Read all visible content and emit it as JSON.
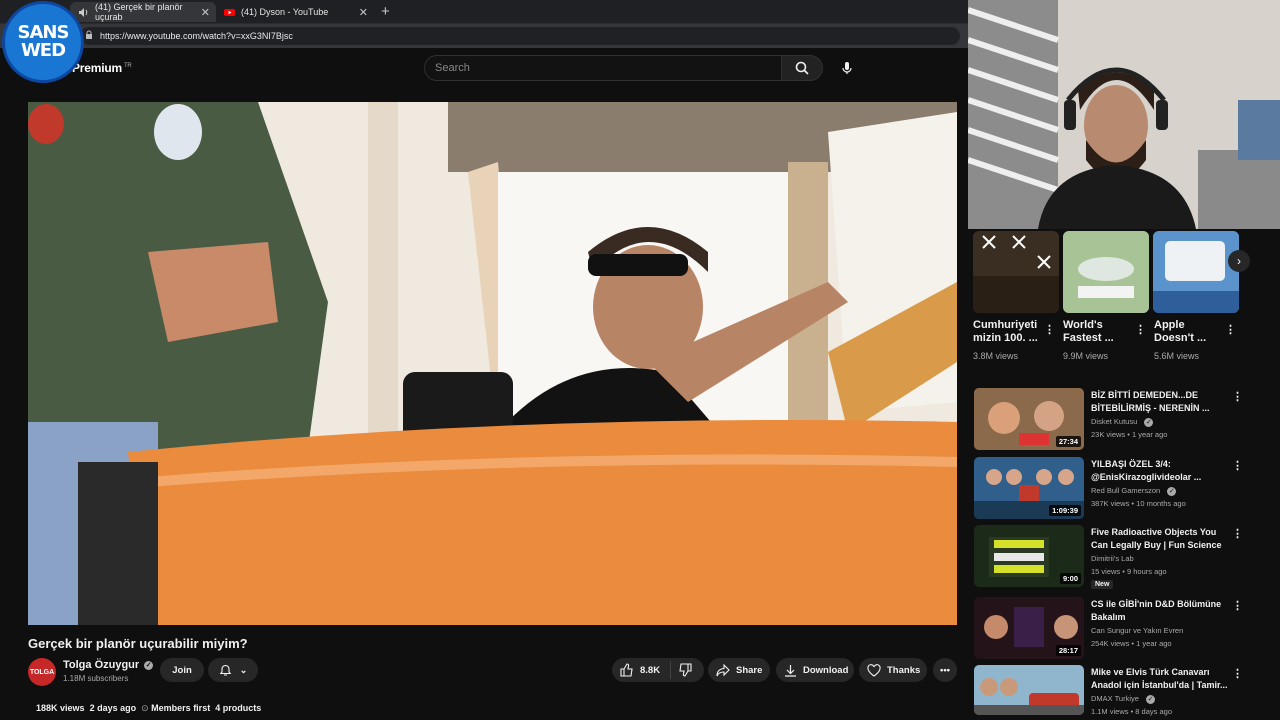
{
  "browser": {
    "tabs": [
      {
        "label": "(41) Gerçek bir planör uçurab"
      },
      {
        "label": "(41) Dyson - YouTube"
      }
    ],
    "url": "https://www.youtube.com/watch?v=xxG3NI7Bjsc"
  },
  "overlay_logo": {
    "line1": "SANS",
    "line2": "WED"
  },
  "header": {
    "brand": "Premium",
    "brand_sup": "TR",
    "search_placeholder": "Search"
  },
  "video": {
    "title": "Gerçek bir planör uçurabilir miyim?",
    "channel": {
      "name": "Tolga Özuygur",
      "subscribers": "1.18M subscribers",
      "avatar_text": "TOLGA"
    },
    "join_label": "Join",
    "likes": "8.8K",
    "share_label": "Share",
    "download_label": "Download",
    "thanks_label": "Thanks",
    "stats": {
      "views": "188K views",
      "age": "2 days ago",
      "members": "Members first",
      "products": "4 products"
    }
  },
  "shorts": [
    {
      "title_line1": "Cumhuriyeti",
      "title_line2": "mizin 100. ...",
      "views": "3.8M views",
      "color": "#2b241c"
    },
    {
      "title_line1": "World's",
      "title_line2": "Fastest ...",
      "views": "9.9M views",
      "color": "#8fb07a"
    },
    {
      "title_line1": "Apple",
      "title_line2": "Doesn't ...",
      "views": "5.6M views",
      "color": "#3b6fb0"
    }
  ],
  "related": [
    {
      "title": "BİZ BİTTİ DEMEDEN...DE BİTEBİLİRMİŞ - NERENİN ...",
      "channel": "Disket Kutusu",
      "views": "23K views • 1 year ago",
      "duration": "27:34",
      "verified": true,
      "color": "#7a5a3a",
      "badge": ""
    },
    {
      "title": "YILBAŞI ÖZEL 3/4: @EnisKirazoglivideolar ...",
      "channel": "Red Bull Gamerszon",
      "views": "387K views • 10 months ago",
      "duration": "1:09:39",
      "verified": true,
      "color": "#2f5f8a",
      "badge": ""
    },
    {
      "title": "Five Radioactive Objects You Can Legally Buy | Fun Science",
      "channel": "Dimitrii's Lab",
      "views": "15 views • 9 hours ago",
      "duration": "9:00",
      "verified": false,
      "color": "#1c2a1a",
      "badge": "New"
    },
    {
      "title": "CS ile GİBİ'nin D&D Bölümüne Bakalım",
      "channel": "Can Sungur ve Yakın Evren",
      "views": "254K views • 1 year ago",
      "duration": "28:17",
      "verified": false,
      "color": "#3a1d1d",
      "badge": ""
    },
    {
      "title": "Mike ve Elvis Türk Canavarı Anadol için İstanbul'da | Tamir...",
      "channel": "DMAX Turkiye",
      "views": "1.1M views • 8 days ago",
      "duration": "",
      "verified": true,
      "color": "#5a7a8a",
      "badge": ""
    }
  ]
}
